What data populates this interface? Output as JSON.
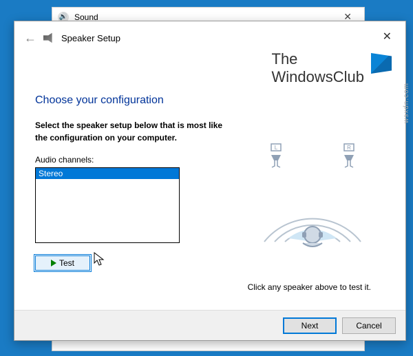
{
  "sound_window": {
    "title": "Sound"
  },
  "wizard": {
    "title": "Speaker Setup",
    "heading": "Choose your configuration",
    "instruction": "Select the speaker setup below that is most like the configuration on your computer.",
    "channels_label": "Audio channels:",
    "channels": [
      "Stereo"
    ],
    "selected_channel": "Stereo",
    "test_label": "Test",
    "hint": "Click any speaker above to test it.",
    "next_label": "Next",
    "cancel_label": "Cancel"
  },
  "logo": {
    "line1": "The",
    "line2": "WindowsClub"
  },
  "watermark": "wsxdn.com",
  "speakers": {
    "left": "L",
    "right": "R"
  }
}
